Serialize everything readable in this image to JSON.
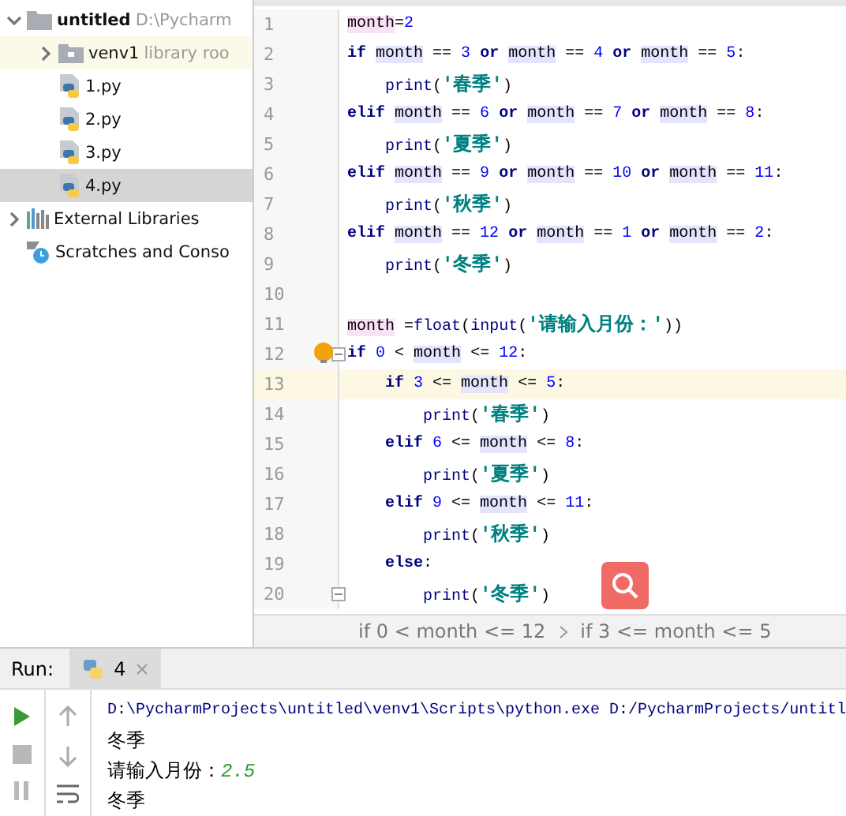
{
  "project_tree": [
    {
      "label": "untitled",
      "hint": "D:\\Pycharm",
      "kind": "folder",
      "expanded": true,
      "selected": false,
      "children": [
        {
          "label": "venv1",
          "hint": "library roo",
          "kind": "lib-folder",
          "expanded": false,
          "selected": false
        },
        {
          "label": "1.py",
          "kind": "py",
          "selected": false
        },
        {
          "label": "2.py",
          "kind": "py",
          "selected": false
        },
        {
          "label": "3.py",
          "kind": "py",
          "selected": false
        },
        {
          "label": "4.py",
          "kind": "py",
          "selected": true
        }
      ]
    },
    {
      "label": "External Libraries",
      "kind": "libs",
      "expanded": false,
      "selected": false
    },
    {
      "label": "Scratches and Conso",
      "kind": "scratch",
      "selected": false
    }
  ],
  "editor": {
    "lines": [
      {
        "number": "1",
        "tokens": [
          {
            "t": "month",
            "kind": "def"
          },
          {
            "t": "=",
            "kind": "plain"
          },
          {
            "t": "2",
            "kind": "num"
          }
        ]
      },
      {
        "number": "2",
        "tokens": [
          {
            "t": "if ",
            "kind": "kw"
          },
          {
            "t": "month",
            "kind": "var"
          },
          {
            "t": " == ",
            "kind": "plain"
          },
          {
            "t": "3 ",
            "kind": "num"
          },
          {
            "t": "or ",
            "kind": "kw"
          },
          {
            "t": "month",
            "kind": "var"
          },
          {
            "t": " == ",
            "kind": "plain"
          },
          {
            "t": "4 ",
            "kind": "num"
          },
          {
            "t": "or ",
            "kind": "kw"
          },
          {
            "t": "month",
            "kind": "var"
          },
          {
            "t": " == ",
            "kind": "plain"
          },
          {
            "t": "5",
            "kind": "num"
          },
          {
            "t": ":",
            "kind": "plain"
          }
        ]
      },
      {
        "number": "3",
        "tokens": [
          {
            "t": "    print",
            "kind": "fn"
          },
          {
            "t": "(",
            "kind": "plain"
          },
          {
            "t": "'春季'",
            "kind": "str"
          },
          {
            "t": ")",
            "kind": "plain"
          }
        ]
      },
      {
        "number": "4",
        "tokens": [
          {
            "t": "elif ",
            "kind": "kw"
          },
          {
            "t": "month",
            "kind": "var"
          },
          {
            "t": " == ",
            "kind": "plain"
          },
          {
            "t": "6 ",
            "kind": "num"
          },
          {
            "t": "or ",
            "kind": "kw"
          },
          {
            "t": "month",
            "kind": "var"
          },
          {
            "t": " == ",
            "kind": "plain"
          },
          {
            "t": "7 ",
            "kind": "num"
          },
          {
            "t": "or ",
            "kind": "kw"
          },
          {
            "t": "month",
            "kind": "var"
          },
          {
            "t": " == ",
            "kind": "plain"
          },
          {
            "t": "8",
            "kind": "num"
          },
          {
            "t": ":",
            "kind": "plain"
          }
        ]
      },
      {
        "number": "5",
        "tokens": [
          {
            "t": "    print",
            "kind": "fn"
          },
          {
            "t": "(",
            "kind": "plain"
          },
          {
            "t": "'夏季'",
            "kind": "str"
          },
          {
            "t": ")",
            "kind": "plain"
          }
        ]
      },
      {
        "number": "6",
        "tokens": [
          {
            "t": "elif ",
            "kind": "kw"
          },
          {
            "t": "month",
            "kind": "var"
          },
          {
            "t": " == ",
            "kind": "plain"
          },
          {
            "t": "9 ",
            "kind": "num"
          },
          {
            "t": "or ",
            "kind": "kw"
          },
          {
            "t": "month",
            "kind": "var"
          },
          {
            "t": " == ",
            "kind": "plain"
          },
          {
            "t": "10 ",
            "kind": "num"
          },
          {
            "t": "or ",
            "kind": "kw"
          },
          {
            "t": "month",
            "kind": "var"
          },
          {
            "t": " == ",
            "kind": "plain"
          },
          {
            "t": "11",
            "kind": "num"
          },
          {
            "t": ":",
            "kind": "plain"
          }
        ]
      },
      {
        "number": "7",
        "tokens": [
          {
            "t": "    print",
            "kind": "fn"
          },
          {
            "t": "(",
            "kind": "plain"
          },
          {
            "t": "'秋季'",
            "kind": "str"
          },
          {
            "t": ")",
            "kind": "plain"
          }
        ]
      },
      {
        "number": "8",
        "tokens": [
          {
            "t": "elif ",
            "kind": "kw"
          },
          {
            "t": "month",
            "kind": "var"
          },
          {
            "t": " == ",
            "kind": "plain"
          },
          {
            "t": "12 ",
            "kind": "num"
          },
          {
            "t": "or ",
            "kind": "kw"
          },
          {
            "t": "month",
            "kind": "var"
          },
          {
            "t": " == ",
            "kind": "plain"
          },
          {
            "t": "1 ",
            "kind": "num"
          },
          {
            "t": "or ",
            "kind": "kw"
          },
          {
            "t": "month",
            "kind": "var"
          },
          {
            "t": " == ",
            "kind": "plain"
          },
          {
            "t": "2",
            "kind": "num"
          },
          {
            "t": ":",
            "kind": "plain"
          }
        ]
      },
      {
        "number": "9",
        "tokens": [
          {
            "t": "    print",
            "kind": "fn"
          },
          {
            "t": "(",
            "kind": "plain"
          },
          {
            "t": "'冬季'",
            "kind": "str"
          },
          {
            "t": ")",
            "kind": "plain"
          }
        ]
      },
      {
        "number": "10"
      },
      {
        "number": "11",
        "tokens": [
          {
            "t": "month",
            "kind": "def"
          },
          {
            "t": " =",
            "kind": "plain"
          },
          {
            "t": "float",
            "kind": "fn"
          },
          {
            "t": "(",
            "kind": "plain"
          },
          {
            "t": "input",
            "kind": "fn"
          },
          {
            "t": "(",
            "kind": "plain"
          },
          {
            "t": "'请输入月份：'",
            "kind": "str"
          },
          {
            "t": "))",
            "kind": "plain"
          }
        ]
      },
      {
        "number": "12",
        "fold": true,
        "bulb": true,
        "tokens": [
          {
            "t": "if ",
            "kind": "kw"
          },
          {
            "t": "0",
            "kind": "num"
          },
          {
            "t": " < ",
            "kind": "plain"
          },
          {
            "t": "month",
            "kind": "var"
          },
          {
            "t": " <= ",
            "kind": "plain"
          },
          {
            "t": "12",
            "kind": "num"
          },
          {
            "t": ":",
            "kind": "plain"
          }
        ]
      },
      {
        "number": "13",
        "current": true,
        "tokens": [
          {
            "t": "    if ",
            "kind": "kw"
          },
          {
            "t": "3",
            "kind": "num"
          },
          {
            "t": " <= ",
            "kind": "plain"
          },
          {
            "t": "month",
            "kind": "var"
          },
          {
            "t": " <= ",
            "kind": "plain"
          },
          {
            "t": "5",
            "kind": "num"
          },
          {
            "t": ":",
            "kind": "plain"
          }
        ]
      },
      {
        "number": "14",
        "tokens": [
          {
            "t": "        print",
            "kind": "fn"
          },
          {
            "t": "(",
            "kind": "plain"
          },
          {
            "t": "'春季'",
            "kind": "str"
          },
          {
            "t": ")",
            "kind": "plain"
          }
        ]
      },
      {
        "number": "15",
        "tokens": [
          {
            "t": "    elif ",
            "kind": "kw"
          },
          {
            "t": "6",
            "kind": "num"
          },
          {
            "t": " <= ",
            "kind": "plain"
          },
          {
            "t": "month",
            "kind": "var"
          },
          {
            "t": " <= ",
            "kind": "plain"
          },
          {
            "t": "8",
            "kind": "num"
          },
          {
            "t": ":",
            "kind": "plain"
          }
        ]
      },
      {
        "number": "16",
        "tokens": [
          {
            "t": "        print",
            "kind": "fn"
          },
          {
            "t": "(",
            "kind": "plain"
          },
          {
            "t": "'夏季'",
            "kind": "str"
          },
          {
            "t": ")",
            "kind": "plain"
          }
        ]
      },
      {
        "number": "17",
        "tokens": [
          {
            "t": "    elif ",
            "kind": "kw"
          },
          {
            "t": "9",
            "kind": "num"
          },
          {
            "t": " <= ",
            "kind": "plain"
          },
          {
            "t": "month",
            "kind": "var"
          },
          {
            "t": " <= ",
            "kind": "plain"
          },
          {
            "t": "11",
            "kind": "num"
          },
          {
            "t": ":",
            "kind": "plain"
          }
        ]
      },
      {
        "number": "18",
        "tokens": [
          {
            "t": "        print",
            "kind": "fn"
          },
          {
            "t": "(",
            "kind": "plain"
          },
          {
            "t": "'秋季'",
            "kind": "str"
          },
          {
            "t": ")",
            "kind": "plain"
          }
        ]
      },
      {
        "number": "19",
        "tokens": [
          {
            "t": "    else",
            "kind": "kw"
          },
          {
            "t": ":",
            "kind": "plain"
          }
        ]
      },
      {
        "number": "20",
        "fold": true,
        "tokens": [
          {
            "t": "        print",
            "kind": "fn"
          },
          {
            "t": "(",
            "kind": "plain"
          },
          {
            "t": "'冬季'",
            "kind": "str"
          },
          {
            "t": ")",
            "kind": "plain"
          }
        ]
      }
    ],
    "breadcrumbs": [
      "if 0 < month <= 12",
      "if 3 <= month <= 5"
    ]
  },
  "run_panel": {
    "label": "Run:",
    "tab": {
      "label": "4",
      "selected": true
    },
    "output": [
      {
        "text": "D:\\PycharmProjects\\untitled\\venv1\\Scripts\\python.exe D:/PycharmProjects/untitl",
        "kind": "command"
      },
      {
        "text": "冬季",
        "kind": "stdout"
      },
      {
        "text": "请输入月份：",
        "input": "2.5",
        "kind": "prompt"
      },
      {
        "text": "冬季",
        "kind": "stdout"
      }
    ]
  }
}
